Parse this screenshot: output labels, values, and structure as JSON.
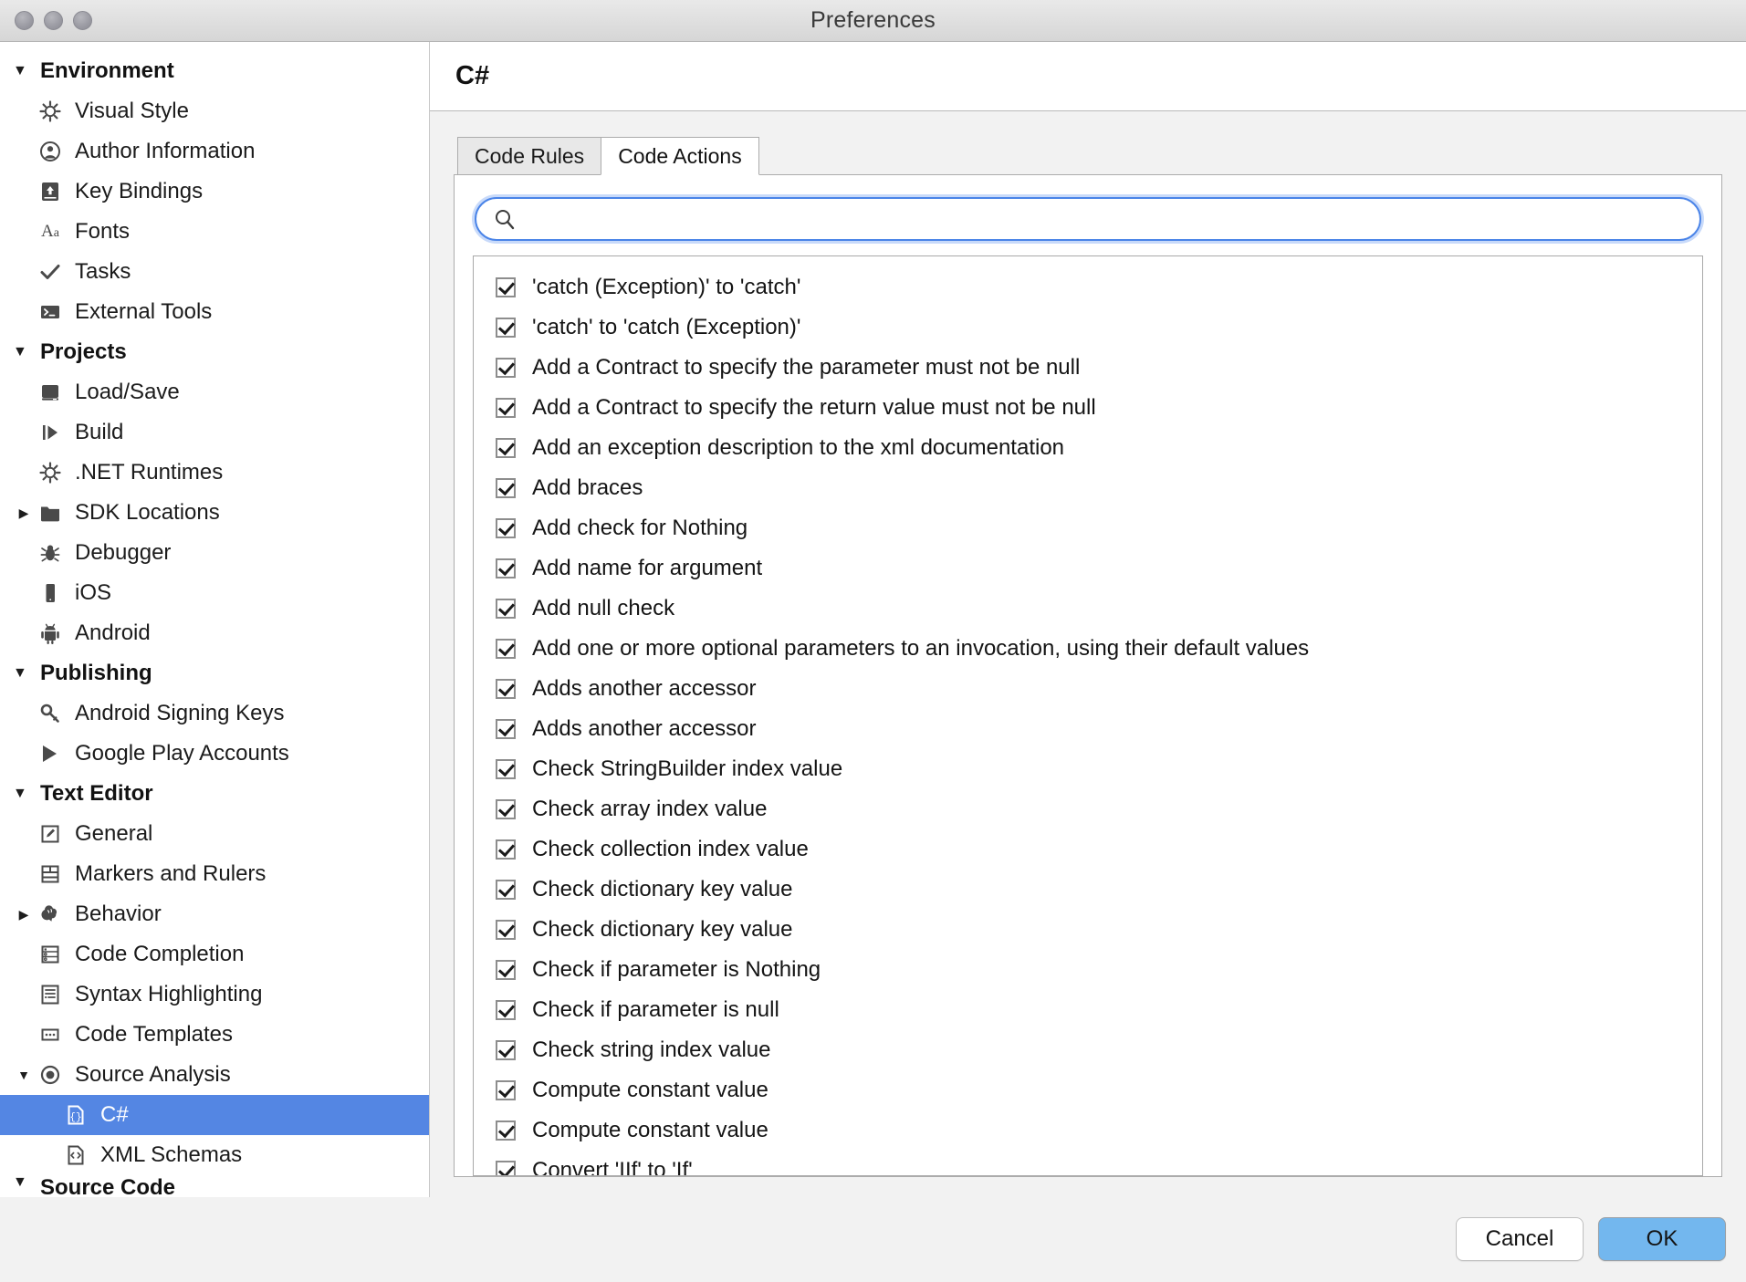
{
  "window": {
    "title": "Preferences",
    "traffic_lights": [
      "close",
      "minimize",
      "zoom"
    ]
  },
  "colors": {
    "selection_blue": "#5486e3",
    "ok_button_blue": "#73b7ee",
    "focus_ring_blue": "#4a84e8",
    "titlebar_gray": "#dedede",
    "panel_gray": "#f2f2f2"
  },
  "sidebar": {
    "groups": [
      {
        "label": "Environment",
        "expanded": true,
        "items": [
          {
            "label": "Visual Style",
            "icon": "gear-icon",
            "twisty": "none"
          },
          {
            "label": "Author Information",
            "icon": "person-icon",
            "twisty": "none"
          },
          {
            "label": "Key Bindings",
            "icon": "keyboard-icon",
            "twisty": "none"
          },
          {
            "label": "Fonts",
            "icon": "fonts-aa-icon",
            "twisty": "none"
          },
          {
            "label": "Tasks",
            "icon": "checkmark-icon",
            "twisty": "none"
          },
          {
            "label": "External Tools",
            "icon": "terminal-icon",
            "twisty": "none"
          }
        ]
      },
      {
        "label": "Projects",
        "expanded": true,
        "items": [
          {
            "label": "Load/Save",
            "icon": "disk-icon",
            "twisty": "none"
          },
          {
            "label": "Build",
            "icon": "build-run-icon",
            "twisty": "none"
          },
          {
            "label": ".NET Runtimes",
            "icon": "gear-icon",
            "twisty": "none"
          },
          {
            "label": "SDK Locations",
            "icon": "folder-icon",
            "twisty": "collapsed"
          },
          {
            "label": "Debugger",
            "icon": "bug-icon",
            "twisty": "none"
          },
          {
            "label": "iOS",
            "icon": "phone-icon",
            "twisty": "none"
          },
          {
            "label": "Android",
            "icon": "android-icon",
            "twisty": "none"
          }
        ]
      },
      {
        "label": "Publishing",
        "expanded": true,
        "items": [
          {
            "label": "Android Signing Keys",
            "icon": "key-icon",
            "twisty": "none"
          },
          {
            "label": "Google Play Accounts",
            "icon": "play-store-icon",
            "twisty": "none"
          }
        ]
      },
      {
        "label": "Text Editor",
        "expanded": true,
        "items": [
          {
            "label": "General",
            "icon": "pencil-document-icon",
            "twisty": "none"
          },
          {
            "label": "Markers and Rulers",
            "icon": "rulers-icon",
            "twisty": "none"
          },
          {
            "label": "Behavior",
            "icon": "brain-icon",
            "twisty": "collapsed"
          },
          {
            "label": "Code Completion",
            "icon": "list-icon",
            "twisty": "none"
          },
          {
            "label": "Syntax Highlighting",
            "icon": "syntax-doc-icon",
            "twisty": "none"
          },
          {
            "label": "Code Templates",
            "icon": "templates-icon",
            "twisty": "none"
          },
          {
            "label": "Source Analysis",
            "icon": "radio-target-icon",
            "twisty": "expanded"
          },
          {
            "label": "C#",
            "icon": "braces-doc-icon",
            "twisty": "none",
            "selected": true,
            "indented": true
          },
          {
            "label": "XML Schemas",
            "icon": "xml-doc-icon",
            "twisty": "none",
            "indented": true
          }
        ]
      },
      {
        "label": "Source Code",
        "expanded": true,
        "clipped": true,
        "items": []
      }
    ]
  },
  "content": {
    "title": "C#",
    "tabs": [
      {
        "label": "Code Rules",
        "active": false
      },
      {
        "label": "Code Actions",
        "active": true
      }
    ],
    "search": {
      "value": "",
      "placeholder": "",
      "icon": "search-icon"
    },
    "list": {
      "items": [
        {
          "label": "'catch (Exception)' to 'catch'",
          "checked": true
        },
        {
          "label": "'catch' to 'catch (Exception)'",
          "checked": true
        },
        {
          "label": "Add a Contract to specify the parameter must not be null",
          "checked": true
        },
        {
          "label": "Add a Contract to specify the return value must not be null",
          "checked": true
        },
        {
          "label": "Add an exception description to the xml documentation",
          "checked": true
        },
        {
          "label": "Add braces",
          "checked": true
        },
        {
          "label": "Add check for Nothing",
          "checked": true
        },
        {
          "label": "Add name for argument",
          "checked": true
        },
        {
          "label": "Add null check",
          "checked": true
        },
        {
          "label": "Add one or more optional parameters to an invocation, using their default values",
          "checked": true
        },
        {
          "label": "Adds another accessor",
          "checked": true
        },
        {
          "label": "Adds another accessor",
          "checked": true
        },
        {
          "label": "Check StringBuilder index value",
          "checked": true
        },
        {
          "label": "Check array index value",
          "checked": true
        },
        {
          "label": "Check collection index value",
          "checked": true
        },
        {
          "label": "Check dictionary key value",
          "checked": true
        },
        {
          "label": "Check dictionary key value",
          "checked": true
        },
        {
          "label": "Check if parameter is Nothing",
          "checked": true
        },
        {
          "label": "Check if parameter is null",
          "checked": true
        },
        {
          "label": "Check string index value",
          "checked": true
        },
        {
          "label": "Compute constant value",
          "checked": true
        },
        {
          "label": "Compute constant value",
          "checked": true
        },
        {
          "label": "Convert 'IIf' to 'If'",
          "checked": true
        }
      ]
    }
  },
  "footer": {
    "cancel_label": "Cancel",
    "ok_label": "OK"
  }
}
